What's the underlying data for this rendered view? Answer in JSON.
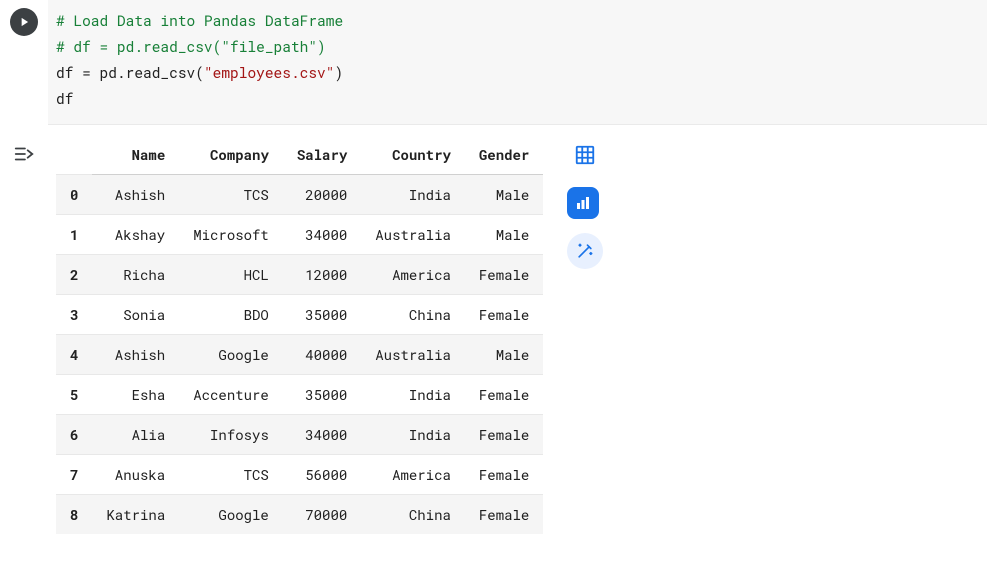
{
  "code": {
    "line1": "# Load Data into Pandas DataFrame",
    "line2": "# df = pd.read_csv(\"file_path\")",
    "line3_pre": "df = pd.read_csv(",
    "line3_str": "\"employees.csv\"",
    "line3_post": ")",
    "line4": "df"
  },
  "table": {
    "columns": [
      "Name",
      "Company",
      "Salary",
      "Country",
      "Gender"
    ],
    "index": [
      "0",
      "1",
      "2",
      "3",
      "4",
      "5",
      "6",
      "7",
      "8"
    ],
    "rows": [
      [
        "Ashish",
        "TCS",
        "20000",
        "India",
        "Male"
      ],
      [
        "Akshay",
        "Microsoft",
        "34000",
        "Australia",
        "Male"
      ],
      [
        "Richa",
        "HCL",
        "12000",
        "America",
        "Female"
      ],
      [
        "Sonia",
        "BDO",
        "35000",
        "China",
        "Female"
      ],
      [
        "Ashish",
        "Google",
        "40000",
        "Australia",
        "Male"
      ],
      [
        "Esha",
        "Accenture",
        "35000",
        "India",
        "Female"
      ],
      [
        "Alia",
        "Infosys",
        "34000",
        "India",
        "Female"
      ],
      [
        "Anuska",
        "TCS",
        "56000",
        "America",
        "Female"
      ],
      [
        "Katrina",
        "Google",
        "70000",
        "China",
        "Female"
      ]
    ]
  },
  "icons": {
    "run": "run-icon",
    "toggle": "toggle-output-icon",
    "grid": "spreadsheet-icon",
    "chart": "chart-icon",
    "wand": "magic-wand-icon"
  }
}
